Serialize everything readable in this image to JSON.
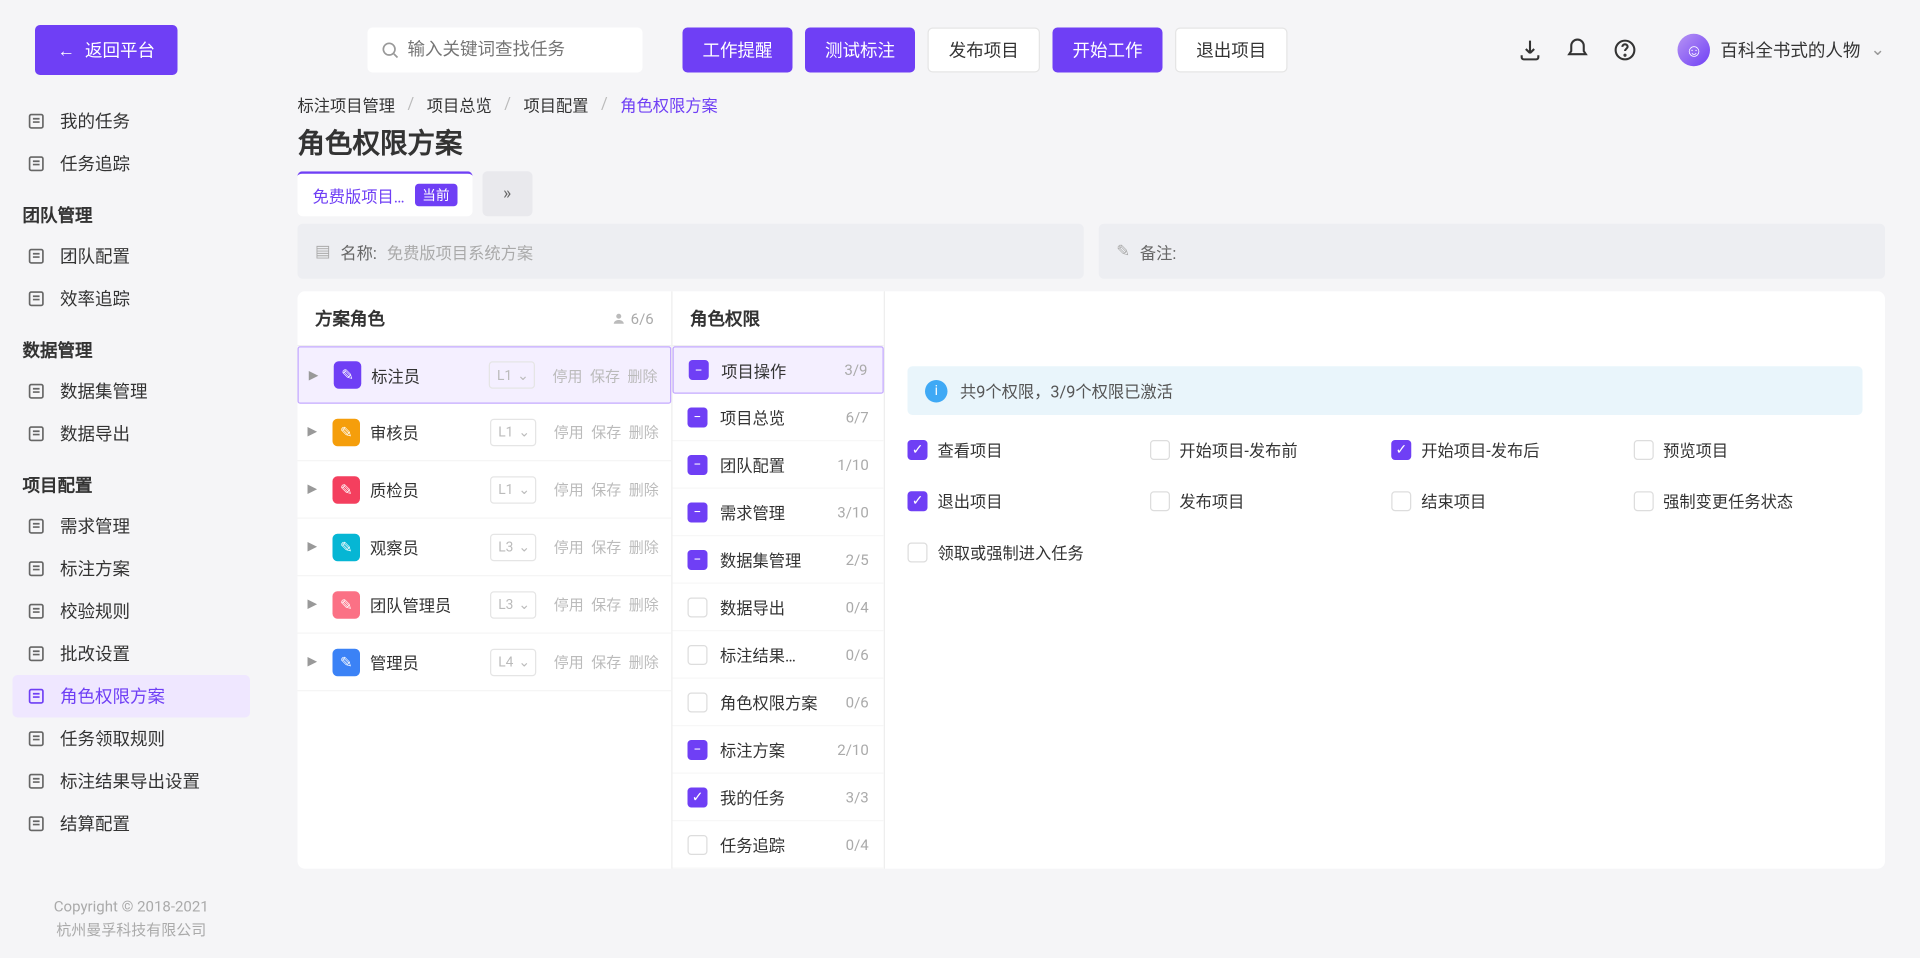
{
  "header": {
    "back": "返回平台",
    "search_placeholder": "输入关键词查找任务",
    "actions": {
      "work_remind": "工作提醒",
      "test_annot": "测试标注",
      "publish": "发布项目",
      "start_work": "开始工作",
      "exit_project": "退出项目"
    },
    "user_name": "百科全书式的人物"
  },
  "sidebar": {
    "items_top": [
      {
        "label": "我的任务"
      },
      {
        "label": "任务追踪"
      }
    ],
    "group_team": "团队管理",
    "items_team": [
      {
        "label": "团队配置"
      },
      {
        "label": "效率追踪"
      }
    ],
    "group_data": "数据管理",
    "items_data": [
      {
        "label": "数据集管理"
      },
      {
        "label": "数据导出"
      }
    ],
    "group_project": "项目配置",
    "items_project": [
      {
        "label": "需求管理"
      },
      {
        "label": "标注方案"
      },
      {
        "label": "校验规则"
      },
      {
        "label": "批改设置"
      },
      {
        "label": "角色权限方案"
      },
      {
        "label": "任务领取规则"
      },
      {
        "label": "标注结果导出设置"
      },
      {
        "label": "结算配置"
      }
    ],
    "footer_line1": "Copyright © 2018-2021",
    "footer_line2": "杭州曼孚科技有限公司"
  },
  "breadcrumbs": {
    "a": "标注项目管理",
    "b": "项目总览",
    "c": "项目配置",
    "d": "角色权限方案"
  },
  "page_title": "角色权限方案",
  "tab": {
    "label": "免费版项目…",
    "badge": "当前"
  },
  "info": {
    "name_label": "名称:",
    "name_value": "免费版项目系统方案",
    "remark_label": "备注:"
  },
  "roles_panel": {
    "title": "方案角色",
    "count": "6/6",
    "rows": [
      {
        "name": "标注员",
        "color": "#6f3ff5",
        "level": "L1"
      },
      {
        "name": "审核员",
        "color": "#f59e0b",
        "level": "L1"
      },
      {
        "name": "质检员",
        "color": "#f43f5e",
        "level": "L1"
      },
      {
        "name": "观察员",
        "color": "#06b6d4",
        "level": "L3"
      },
      {
        "name": "团队管理员",
        "color": "#fb7185",
        "level": "L3"
      },
      {
        "name": "管理员",
        "color": "#3b82f6",
        "level": "L4"
      }
    ],
    "action_stop": "停用",
    "action_save": "保存",
    "action_delete": "删除"
  },
  "perm_groups": {
    "title": "角色权限",
    "rows": [
      {
        "name": "项目操作",
        "count": "3/9",
        "state": "part",
        "active": true
      },
      {
        "name": "项目总览",
        "count": "6/7",
        "state": "part"
      },
      {
        "name": "团队配置",
        "count": "1/10",
        "state": "part"
      },
      {
        "name": "需求管理",
        "count": "3/10",
        "state": "part"
      },
      {
        "name": "数据集管理",
        "count": "2/5",
        "state": "part"
      },
      {
        "name": "数据导出",
        "count": "0/4",
        "state": "none"
      },
      {
        "name": "标注结果…",
        "count": "0/6",
        "state": "none"
      },
      {
        "name": "角色权限方案",
        "count": "0/6",
        "state": "none"
      },
      {
        "name": "标注方案",
        "count": "2/10",
        "state": "part"
      },
      {
        "name": "我的任务",
        "count": "3/3",
        "state": "full"
      },
      {
        "name": "任务追踪",
        "count": "0/4",
        "state": "none"
      }
    ]
  },
  "detail": {
    "banner": "共9个权限，3/9个权限已激活",
    "perms": [
      {
        "label": "查看项目",
        "on": true
      },
      {
        "label": "开始项目-发布前",
        "on": false
      },
      {
        "label": "开始项目-发布后",
        "on": true
      },
      {
        "label": "预览项目",
        "on": false
      },
      {
        "label": "退出项目",
        "on": true
      },
      {
        "label": "发布项目",
        "on": false
      },
      {
        "label": "结束项目",
        "on": false
      },
      {
        "label": "强制变更任务状态",
        "on": false
      },
      {
        "label": "领取或强制进入任务",
        "on": false
      }
    ]
  }
}
